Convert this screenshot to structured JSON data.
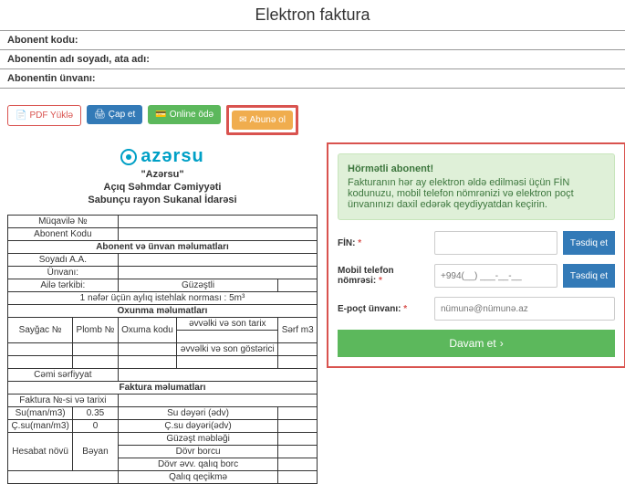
{
  "page": {
    "title": "Elektron faktura"
  },
  "info": {
    "code_label": "Abonent kodu:",
    "name_label": "Abonentin adı soyadı, ata adı:",
    "address_label": "Abonentin ünvanı:"
  },
  "toolbar": {
    "pdf": "PDF Yüklə",
    "print": "Çap et",
    "pay": "Online ödə",
    "subscribe": "Abunə ol"
  },
  "doc": {
    "brand": "azərsu",
    "quoted": "\"Azərsu\"",
    "line1": "Açıq Səhmdar Cəmiyyəti",
    "line2": "Sabunçu rayon Sukanal İdarəsi",
    "rows": {
      "contract": "Müqavilə №",
      "abonent_code": "Abonent Kodu",
      "sec_abonent": "Abonent və ünvan məlumatları",
      "surname": "Soyadı A.A.",
      "address": "Ünvanı:",
      "family": "Ailə tərkibi:",
      "family_val": "Güzəştli",
      "norm": "1 nəfər üçün aylıq istehlak norması : 5m³",
      "sec_read": "Oxunma məlumatları",
      "counter": "Sayğac №",
      "seal": "Plomb №",
      "read_code": "Oxuma kodu",
      "prev_date": "əvvəlki və son tarix",
      "serf": "Sərf m3",
      "prev_ind": "əvvəlki və son göstərici",
      "total_cons": "Cəmi sərfiyyat",
      "sec_invoice": "Faktura məlumatları",
      "inv_no": "Faktura №-si və tarixi",
      "su_man": "Su(man/m3)",
      "su_man_v": "0.35",
      "su_price": "Su dəyəri (ədv)",
      "csu_man": "Ç.su(man/m3)",
      "csu_man_v": "0",
      "csu_price": "Ç.su dəyəri(ədv)",
      "guz_amount": "Güzəşt məbləği",
      "acct_type": "Hesabat növü",
      "acct_type_v": "Bəyan",
      "debt": "Dövr borcu",
      "prev_bal": "Dövr əvv. qalıq borc",
      "prev_kred": "Qalıq qeçikmə"
    }
  },
  "panel": {
    "dear": "Hörmətli abonent!",
    "msg": "Fakturanın hər ay elektron əldə edilməsi üçün FİN kodunuzu, mobil telefon nömrənizi və elektron poçt ünvanınızı daxil edərək qeydiyyatdan keçirin.",
    "fin": "FİN:",
    "mobile": "Mobil telefon nömrəsi:",
    "mobile_ph": "+994(__) ___-__-__",
    "email": "E-poçt ünvanı:",
    "email_ph": "nümunə@nümunə.az",
    "confirm": "Təsdiq et",
    "continue": "Davam et"
  }
}
